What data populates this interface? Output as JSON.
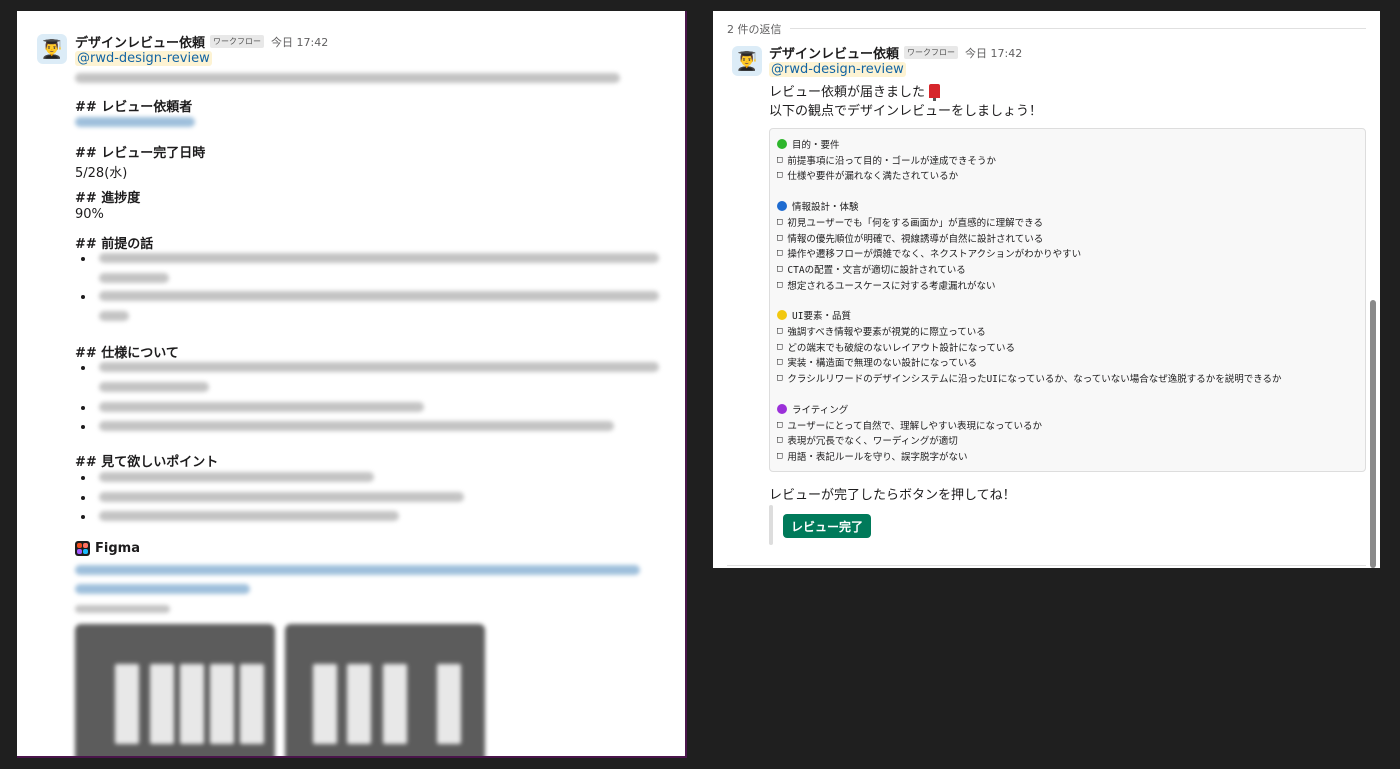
{
  "left": {
    "sender": "デザインレビュー依頼",
    "badge": "ワークフロー",
    "time": "今日 17:42",
    "mention": "@rwd-design-review",
    "sections": [
      {
        "heading": "## レビュー依頼者",
        "value": ""
      },
      {
        "heading": "## レビュー完了日時",
        "value": "5/28(水)"
      },
      {
        "heading": "## 進捗度",
        "value": "90%"
      },
      {
        "heading": "## 前提の話",
        "value": ""
      },
      {
        "heading": "## 仕様について",
        "value": ""
      },
      {
        "heading": "## 見て欲しいポイント",
        "value": ""
      }
    ],
    "figma_label": "Figma"
  },
  "right": {
    "reply_count": "2 件の返信",
    "sender": "デザインレビュー依頼",
    "badge": "ワークフロー",
    "time": "今日 17:42",
    "mention": "@rwd-design-review",
    "line1": "レビュー依頼が届きました",
    "line2": "以下の観点でデザインレビューをしましょう！",
    "checklist": [
      {
        "type": "header",
        "color": "#2eb62c",
        "text": "目的・要件"
      },
      {
        "type": "item",
        "text": "前提事項に沿って目的・ゴールが達成できそうか"
      },
      {
        "type": "item",
        "text": "仕様や要件が漏れなく満たされているか"
      },
      {
        "type": "header",
        "color": "#1e6bd0",
        "text": "情報設計・体験"
      },
      {
        "type": "item",
        "text": "初見ユーザーでも「何をする画面か」が直感的に理解できる"
      },
      {
        "type": "item",
        "text": "情報の優先順位が明確で、視線誘導が自然に設計されている"
      },
      {
        "type": "item",
        "text": "操作や遷移フローが煩雑でなく、ネクストアクションがわかりやすい"
      },
      {
        "type": "item",
        "text": "CTAの配置・文言が適切に設計されている"
      },
      {
        "type": "item",
        "text": "想定されるユースケースに対する考慮漏れがない"
      },
      {
        "type": "header",
        "color": "#f2c80f",
        "text": "UI要素・品質"
      },
      {
        "type": "item",
        "text": "強調すべき情報や要素が視覚的に際立っている"
      },
      {
        "type": "item",
        "text": "どの端末でも破綻のないレイアウト設計になっている"
      },
      {
        "type": "item",
        "text": "実装・構造面で無理のない設計になっている"
      },
      {
        "type": "item",
        "text": "クラシルリワードのデザインシステムに沿ったUIになっているか、なっていない場合なぜ逸脱するかを説明できるか"
      },
      {
        "type": "header",
        "color": "#9b30d9",
        "text": "ライティング"
      },
      {
        "type": "item",
        "text": "ユーザーにとって自然で、理解しやすい表現になっているか"
      },
      {
        "type": "item",
        "text": "表現が冗長でなく、ワーディングが適切"
      },
      {
        "type": "item",
        "text": "用語・表記ルールを守り、誤字脱字がない"
      }
    ],
    "closing": "レビューが完了したらボタンを押してね！",
    "button_label": "レビュー完了"
  },
  "colors": {
    "button": "#007a5a",
    "mention_bg": "#fdf3d3",
    "link": "#1264a3",
    "frame": "#4a154b"
  }
}
